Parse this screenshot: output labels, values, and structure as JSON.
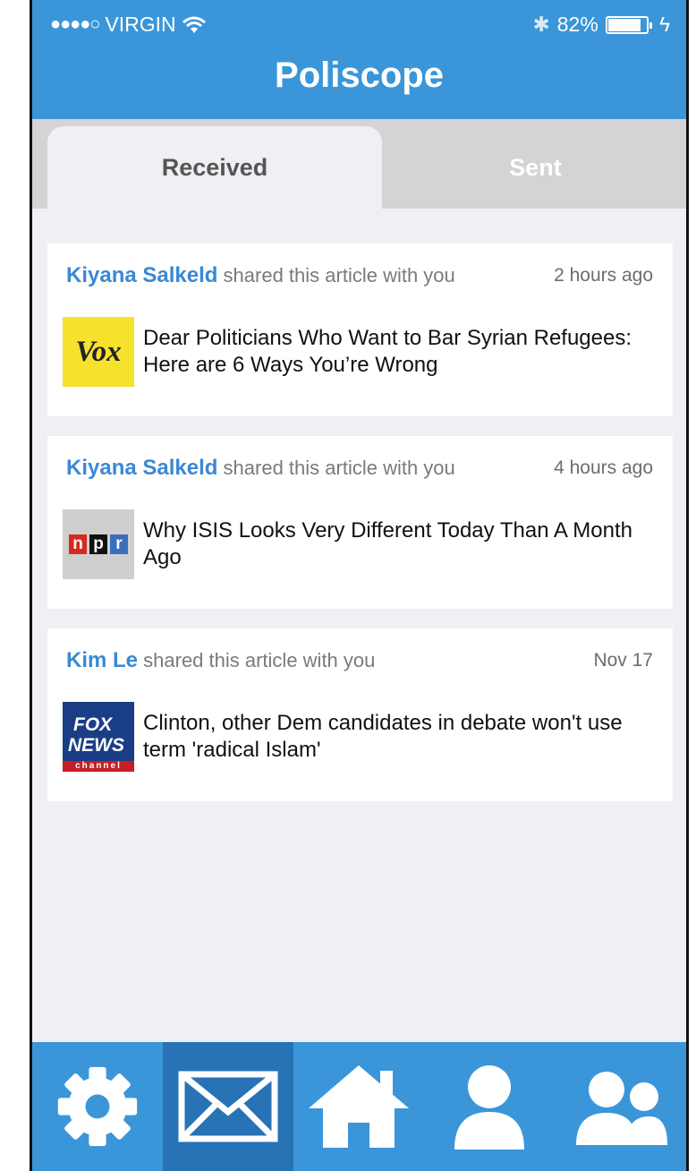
{
  "status_bar": {
    "signal_dots": "●●●●○",
    "carrier": "VIRGIN",
    "bluetooth": "✱",
    "battery_percent": "82%",
    "charging": "ϟ"
  },
  "header": {
    "title": "Poliscope"
  },
  "tabs": [
    {
      "label": "Received",
      "active": true
    },
    {
      "label": "Sent",
      "active": false
    }
  ],
  "feed": [
    {
      "sender": "Kiyana Salkeld",
      "action": "shared this article with you",
      "time": "2 hours ago",
      "source_logo": "Vox",
      "headline": "Dear Politicians Who Want to Bar Syrian Refugees: Here are 6 Ways You’re Wrong"
    },
    {
      "sender": "Kiyana Salkeld",
      "action": "shared this article with you",
      "time": "4 hours ago",
      "source_logo": "npr",
      "headline": "Why ISIS Looks Very Different Today Than A Month Ago"
    },
    {
      "sender": "Kim Le",
      "action": "shared this article with you",
      "time": "Nov 17",
      "source_logo": "FOX NEWS channel",
      "headline": "Clinton, other Dem candidates in debate won't use term 'radical Islam'"
    }
  ],
  "logos": {
    "vox": "Vox",
    "npr_n": "n",
    "npr_p": "p",
    "npr_r": "r",
    "fox_1": "FOX",
    "fox_2": "NEWS",
    "fox_3": "channel"
  },
  "bottom_nav": [
    {
      "icon": "gear-icon",
      "selected": false
    },
    {
      "icon": "mail-icon",
      "selected": true
    },
    {
      "icon": "home-icon",
      "selected": false
    },
    {
      "icon": "person-icon",
      "selected": false
    },
    {
      "icon": "people-icon",
      "selected": false
    }
  ],
  "colors": {
    "brand_blue": "#3a96d9",
    "selected_tab_blue": "#2773b5",
    "sender_blue": "#3a88d4",
    "background": "#efeff4"
  }
}
